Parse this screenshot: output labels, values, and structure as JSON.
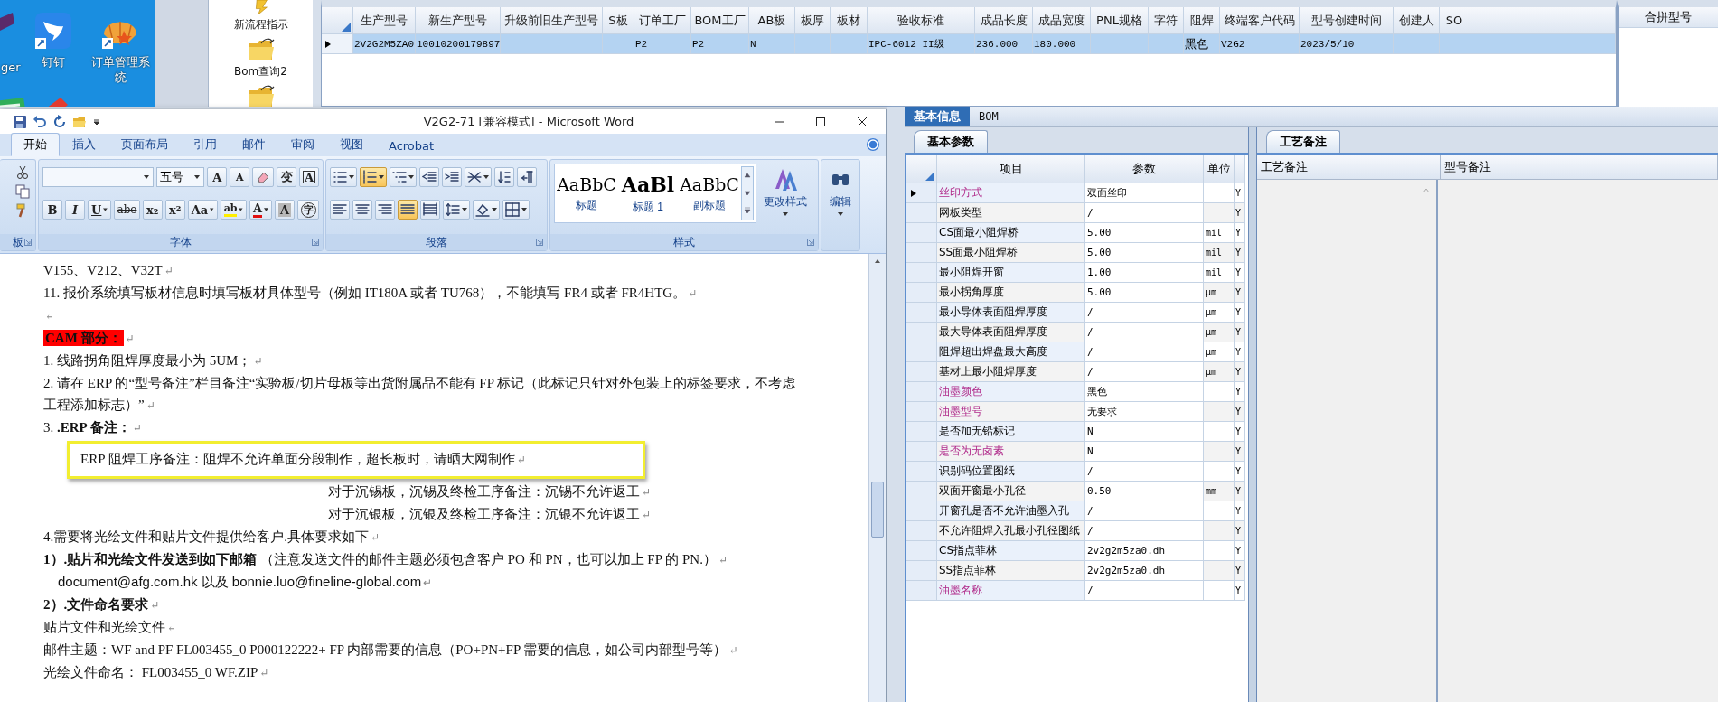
{
  "desktop": {
    "icons": [
      {
        "kind": "cut",
        "label": "ger"
      },
      {
        "kind": "wing",
        "label": "钉钉"
      },
      {
        "kind": "shell",
        "label": "订单管理系统"
      },
      {
        "kind": "green"
      },
      {
        "kind": "red"
      }
    ]
  },
  "nav": {
    "items": [
      {
        "kind": "bolt",
        "label": "新流程指示"
      },
      {
        "kind": "folder",
        "label": "Bom查询2"
      },
      {
        "kind": "folder"
      }
    ]
  },
  "grid": {
    "columns": [
      "生产型号",
      "新生产型号",
      "升级前旧生产型号",
      "S板",
      "订单工厂",
      "BOM工厂",
      "AB板",
      "板厚",
      "板材",
      "验收标准",
      "成品长度",
      "成品宽度",
      "PNL规格",
      "字符",
      "阻焊",
      "终端客户代码",
      "型号创建时间",
      "创建人",
      "SO"
    ],
    "rows": [
      {
        "selected": true,
        "cells": [
          "2V2G2M5ZA0",
          "10010200179897",
          null,
          null,
          "P2",
          "P2",
          "N",
          null,
          null,
          "IPC-6012 II级",
          "236.000",
          "180.000",
          null,
          null,
          "黑色",
          "V2G2",
          "2023/5/10",
          null,
          null
        ]
      }
    ]
  },
  "merge_panel": {
    "title": "合拼型号"
  },
  "word": {
    "title": "V2G2-71 [兼容模式] - Microsoft Word",
    "tabs": [
      {
        "label": "开始",
        "selected": true
      },
      {
        "label": "插入",
        "selected": false
      },
      {
        "label": "页面布局",
        "selected": false
      },
      {
        "label": "引用",
        "selected": false
      },
      {
        "label": "邮件",
        "selected": false
      },
      {
        "label": "审阅",
        "selected": false
      },
      {
        "label": "视图",
        "selected": false
      },
      {
        "label": "Acrobat",
        "selected": false
      }
    ],
    "groups": {
      "clipboard": "板",
      "font": "字体",
      "paragraph": "段落",
      "styles": "样式"
    },
    "font_size": "五号",
    "font_row1": [
      {
        "kind": "grow",
        "text": "A"
      },
      {
        "kind": "shrink",
        "text": "A"
      },
      {
        "kind": "clear"
      },
      {
        "kind": "phonetic",
        "text": "变"
      },
      {
        "kind": "border",
        "text": "A"
      }
    ],
    "font_row2": [
      {
        "kind": "bold",
        "text": "B"
      },
      {
        "kind": "italic",
        "text": "I"
      },
      {
        "kind": "underline",
        "text": "U",
        "dropdown": true
      },
      {
        "kind": "strike",
        "text": "abe"
      },
      {
        "kind": "sub",
        "text": "x₂"
      },
      {
        "kind": "sup",
        "text": "x²"
      },
      {
        "kind": "case",
        "text": "Aa",
        "dropdown": true
      },
      {
        "kind": "highlight",
        "text": "ab",
        "dropdown": true
      },
      {
        "kind": "color",
        "text": "A",
        "dropdown": true
      },
      {
        "kind": "shade",
        "text": "A"
      },
      {
        "kind": "enclose",
        "text": "字"
      }
    ],
    "para_row1": [
      {
        "kind": "bullets",
        "dropdown": true,
        "selected": false
      },
      {
        "kind": "numbering",
        "dropdown": true,
        "selected": true
      },
      {
        "kind": "multilevel",
        "dropdown": true,
        "selected": false
      },
      {
        "kind": "outdent",
        "selected": false
      },
      {
        "kind": "indent",
        "selected": false
      },
      {
        "kind": "asian",
        "dropdown": true,
        "selected": false
      },
      {
        "kind": "sort",
        "selected": false
      },
      {
        "kind": "marks",
        "selected": false
      }
    ],
    "para_row2": [
      {
        "kind": "left",
        "selected": false
      },
      {
        "kind": "center",
        "selected": false
      },
      {
        "kind": "right",
        "selected": false
      },
      {
        "kind": "justify",
        "selected": true
      },
      {
        "kind": "distributed",
        "selected": false
      },
      {
        "kind": "spacing",
        "dropdown": true,
        "selected": false
      },
      {
        "kind": "shading",
        "dropdown": true,
        "selected": false
      },
      {
        "kind": "border",
        "dropdown": true,
        "selected": false
      }
    ],
    "styles": [
      {
        "sample": "AaBbC",
        "label": "标题"
      },
      {
        "sample": "AaBl",
        "label": "标题 1"
      },
      {
        "sample": "AaBbC",
        "label": "副标题"
      }
    ],
    "change_styles": "更改样式",
    "editing": "编辑",
    "paragraphs": [
      {
        "kind": "plain",
        "text": "V155、V212、V32T",
        "mark": "↵"
      },
      {
        "kind": "plain",
        "text": "11. 报价系统填写板材信息时填写板材具体型号（例如 IT180A 或者 TU768），不能填写 FR4 或者 FR4HTG。",
        "mark": "↵"
      },
      {
        "kind": "blank",
        "mark": "↵"
      },
      {
        "kind": "heading",
        "text": "CAM 部分：",
        "mark": "↵"
      },
      {
        "kind": "plain",
        "text": "1.   线路拐角阻焊厚度最小为 5UM；",
        "mark": "↵"
      },
      {
        "kind": "plain",
        "text": "2. 请在 ERP 的“型号备注”栏目备注“实验板/切片母板等出货附属品不能有 FP 标记（此标记只针对外包装上的标签要求，不考虑工程添加标志）”",
        "mark": "↵"
      },
      {
        "kind": "plain",
        "text": "3. **.ERP 备注：**",
        "mark": "↵"
      },
      {
        "kind": "callout",
        "text": "ERP 阻焊工序备注：阻焊不允许单面分段制作，超长板时，请晒大网制作",
        "mark": "↵"
      },
      {
        "kind": "indent",
        "text": "对于沉锡板，沉锡及终检工序备注：沉锡不允许返工",
        "mark": "↵"
      },
      {
        "kind": "indent",
        "text": "对于沉银板，沉银及终检工序备注：沉银不允许返工",
        "mark": "↵"
      },
      {
        "kind": "plain",
        "text": "4.需要将光绘文件和贴片文件提供给客户.具体要求如下",
        "mark": "↵"
      },
      {
        "kind": "plain",
        "text": "**1）.贴片和光绘文件发送到如下邮箱** （注意发送文件的邮件主题必须包含客户 PO 和 PN，也可以加上 FP 的 PN.）",
        "mark": "↵"
      },
      {
        "kind": "email",
        "text": "document@afg.com.hk 以及 bonnie.luo@fineline-global.com",
        "mark": "↵"
      },
      {
        "kind": "bold",
        "text": "2）.文件命名要求",
        "mark": "↵"
      },
      {
        "kind": "plain",
        "text": "贴片文件和光绘文件",
        "mark": "↵"
      },
      {
        "kind": "plain",
        "text": "邮件主题：WF and PF FL003455_0 P000122222+ FP 内部需要的信息（PO+PN+FP 需要的信息，如公司内部型号等）",
        "mark": "↵"
      },
      {
        "kind": "plain",
        "text": "光绘文件命名： FL003455_0 WF.ZIP",
        "mark": "↵"
      }
    ]
  },
  "erp": {
    "tabs": [
      {
        "label": "基本信息",
        "selected": true
      },
      {
        "label": "BOM",
        "selected": false
      }
    ],
    "params": {
      "tab": "基本参数",
      "columns": [
        "项目",
        "参数",
        "单位"
      ],
      "rows": [
        {
          "name": "丝印方式",
          "value": "双面丝印",
          "flag": "Y",
          "highlight": true,
          "selected": true
        },
        {
          "name": "网板类型",
          "value": "/",
          "flag": "Y",
          "highlight": false,
          "selected": false
        },
        {
          "name": "CS面最小阻焊桥",
          "value": "5.00",
          "unit": "mil",
          "flag": "Y",
          "highlight": false,
          "selected": false
        },
        {
          "name": "SS面最小阻焊桥",
          "value": "5.00",
          "unit": "mil",
          "flag": "Y",
          "highlight": false,
          "selected": false
        },
        {
          "name": "最小阻焊开窗",
          "value": "1.00",
          "unit": "mil",
          "flag": "Y",
          "highlight": false,
          "selected": false
        },
        {
          "name": "最小拐角厚度",
          "value": "5.00",
          "unit": "μm",
          "flag": "Y",
          "highlight": false,
          "selected": false
        },
        {
          "name": "最小导体表面阻焊厚度",
          "value": "/",
          "unit": "μm",
          "flag": "Y",
          "highlight": false,
          "selected": false
        },
        {
          "name": "最大导体表面阻焊厚度",
          "value": "/",
          "unit": "μm",
          "flag": "Y",
          "highlight": false,
          "selected": false
        },
        {
          "name": "阻焊超出焊盘最大高度",
          "value": "/",
          "unit": "μm",
          "flag": "Y",
          "highlight": false,
          "selected": false
        },
        {
          "name": "基材上最小阻焊厚度",
          "value": "/",
          "unit": "μm",
          "flag": "Y",
          "highlight": false,
          "selected": false
        },
        {
          "name": "油墨颜色",
          "value": "黑色",
          "flag": "Y",
          "highlight": true,
          "selected": false
        },
        {
          "name": "油墨型号",
          "value": "无要求",
          "flag": "Y",
          "highlight": true,
          "selected": false
        },
        {
          "name": "是否加无铅标记",
          "value": "N",
          "flag": "Y",
          "highlight": false,
          "selected": false
        },
        {
          "name": "是否为无卤素",
          "value": "N",
          "flag": "Y",
          "highlight": true,
          "selected": false
        },
        {
          "name": "识别码位置图纸",
          "value": "/",
          "flag": "Y",
          "highlight": false,
          "selected": false
        },
        {
          "name": "双面开窗最小孔径",
          "value": "0.50",
          "unit": "mm",
          "flag": "Y",
          "highlight": false,
          "selected": false
        },
        {
          "name": "开窗孔是否不允许油墨入孔",
          "value": "/",
          "flag": "Y",
          "highlight": false,
          "selected": false
        },
        {
          "name": "不允许阻焊入孔最小孔径图纸",
          "value": "/",
          "flag": "Y",
          "highlight": false,
          "selected": false
        },
        {
          "name": "CS指点菲林",
          "value": "2v2g2m5za0.dh",
          "flag": "Y",
          "highlight": false,
          "selected": false
        },
        {
          "name": "SS指点菲林",
          "value": "2v2g2m5za0.dh",
          "flag": "Y",
          "highlight": false,
          "selected": false
        },
        {
          "name": "油墨名称",
          "value": "/",
          "flag": "Y",
          "highlight": true,
          "selected": false
        }
      ]
    },
    "notes": {
      "tab": "工艺备注",
      "columns": [
        "工艺备注",
        "型号备注"
      ]
    }
  }
}
